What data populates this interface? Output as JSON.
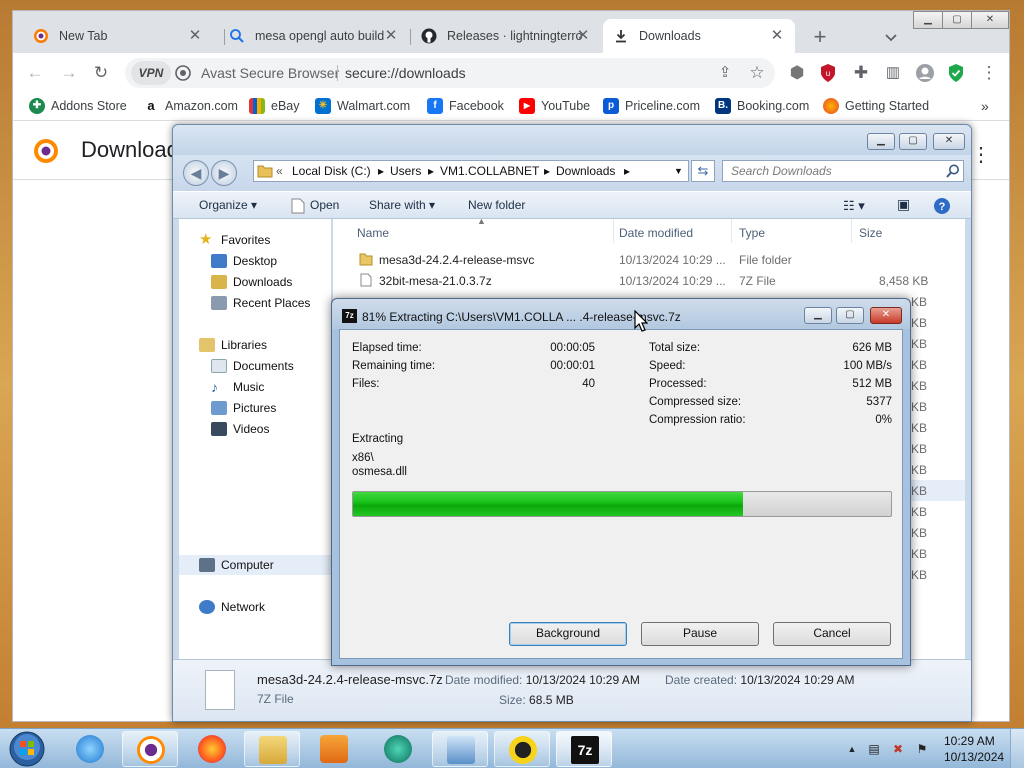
{
  "colors": {
    "accent_green": "#13c013",
    "explorer_frame": "#cbdaea",
    "taskbar": "#93b8d9"
  },
  "browser": {
    "tabs": [
      {
        "label": "New Tab",
        "icon": "avast-browser-icon"
      },
      {
        "label": "mesa opengl auto build",
        "icon": "search-icon"
      },
      {
        "label": "Releases · lightningterro",
        "icon": "github-icon"
      },
      {
        "label": "Downloads",
        "icon": "download-icon"
      }
    ],
    "browser_name": "Avast Secure Browser",
    "url": "secure://downloads",
    "vpn_label": "VPN",
    "bookmarks": [
      "Addons Store",
      "Amazon.com",
      "eBay",
      "Walmart.com",
      "Facebook",
      "YouTube",
      "Priceline.com",
      "Booking.com",
      "Getting Started"
    ],
    "page_title": "Downloads"
  },
  "explorer": {
    "breadcrumb": [
      "Local Disk (C:)",
      "Users",
      "VM1.COLLABNET",
      "Downloads"
    ],
    "search_placeholder": "Search Downloads",
    "commands": {
      "organize": "Organize",
      "open": "Open",
      "share_with": "Share with",
      "new_folder": "New folder"
    },
    "nav": {
      "favorites": "Favorites",
      "desktop": "Desktop",
      "downloads": "Downloads",
      "recent": "Recent Places",
      "libraries": "Libraries",
      "documents": "Documents",
      "music": "Music",
      "pictures": "Pictures",
      "videos": "Videos",
      "computer": "Computer",
      "network": "Network"
    },
    "columns": {
      "name": "Name",
      "date": "Date modified",
      "type": "Type",
      "size": "Size"
    },
    "files": [
      {
        "name": "mesa3d-24.2.4-release-msvc",
        "date": "10/13/2024 10:29 ...",
        "type": "File folder",
        "size": ""
      },
      {
        "name": "32bit-mesa-21.0.3.7z",
        "date": "10/13/2024 10:29 ...",
        "type": "7Z File",
        "size": "8,458 KB"
      }
    ],
    "partial_sizes": [
      "KB",
      "KB",
      "KB",
      "KB",
      "KB",
      "KB",
      "KB",
      "KB",
      "KB",
      "KB",
      "KB",
      "KB",
      "KB",
      "KB"
    ],
    "details": {
      "name": "mesa3d-24.2.4-release-msvc.7z",
      "type": "7Z File",
      "modified_label": "Date modified:",
      "modified": "10/13/2024 10:29 AM",
      "created_label": "Date created:",
      "created": "10/13/2024 10:29 AM",
      "size_label": "Size:",
      "size": "68.5 MB"
    }
  },
  "sevenzip": {
    "icon_label": "7z",
    "title": "81% Extracting C:\\Users\\VM1.COLLA ... .4-release-msvc.7z",
    "progress_fraction": 0.725,
    "left_stats": [
      {
        "label": "Elapsed time:",
        "value": "00:00:05"
      },
      {
        "label": "Remaining time:",
        "value": "00:00:01"
      },
      {
        "label": "Files:",
        "value": "40"
      }
    ],
    "right_stats": [
      {
        "label": "Total size:",
        "value": "626 MB"
      },
      {
        "label": "Speed:",
        "value": "100 MB/s"
      },
      {
        "label": "Processed:",
        "value": "512 MB"
      },
      {
        "label": "Compressed size:",
        "value": "5377"
      },
      {
        "label": "Compression ratio:",
        "value": "0%"
      }
    ],
    "status": "Extracting",
    "current_dir": "x86\\",
    "current_file": "osmesa.dll",
    "buttons": {
      "background": "Background",
      "pause": "Pause",
      "cancel": "Cancel"
    }
  },
  "taskbar": {
    "icons": [
      "start-orb-icon",
      "internet-explorer-icon",
      "avast-browser-icon",
      "firefox-icon",
      "file-explorer-icon",
      "media-player-icon",
      "app-globe-icon",
      "network-monitor-icon",
      "remote-desktop-icon",
      "7zip-icon"
    ],
    "sevenzip_label": "7z",
    "time": "10:29 AM",
    "date": "10/13/2024"
  }
}
